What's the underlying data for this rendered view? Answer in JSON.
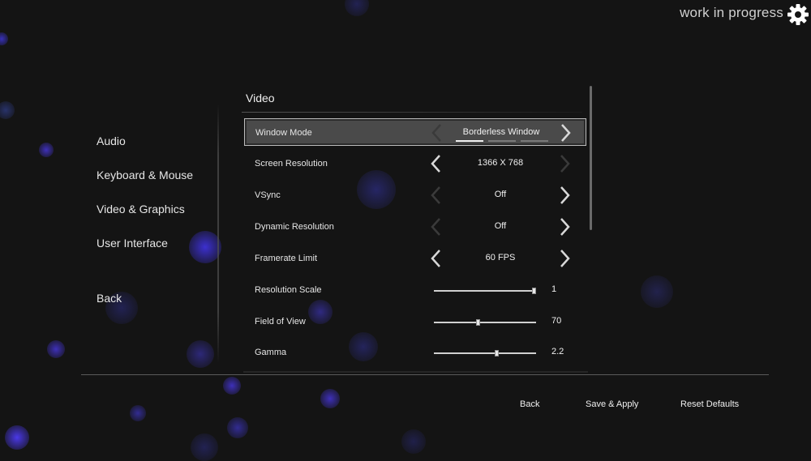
{
  "header": {
    "status_text": "work in progress",
    "settings_icon": "gear-icon"
  },
  "sidebar": {
    "items": [
      {
        "label": "Audio"
      },
      {
        "label": "Keyboard & Mouse"
      },
      {
        "label": "Video & Graphics"
      },
      {
        "label": "User Interface"
      }
    ],
    "back_label": "Back"
  },
  "section": {
    "title": "Video"
  },
  "settings": [
    {
      "label": "Window Mode",
      "value": "Borderless Window",
      "selected": true,
      "left_enabled": false,
      "right_enabled": true,
      "pips": 3,
      "active_pip": 0
    },
    {
      "label": "Screen Resolution",
      "value": "1366 X 768",
      "left_enabled": true,
      "right_enabled": false
    },
    {
      "label": "VSync",
      "value": "Off",
      "left_enabled": false,
      "right_enabled": true
    },
    {
      "label": "Dynamic Resolution",
      "value": "Off",
      "left_enabled": false,
      "right_enabled": true
    },
    {
      "label": "Framerate Limit",
      "value": "60 FPS",
      "left_enabled": true,
      "right_enabled": true
    }
  ],
  "sliders": [
    {
      "label": "Resolution Scale",
      "value": "1",
      "level": 1.0
    },
    {
      "label": "Field of View",
      "value": "70",
      "level": 0.43
    },
    {
      "label": "Gamma",
      "value": "2.2",
      "level": 0.62
    }
  ],
  "footer": {
    "back_label": "Back",
    "save_label": "Save & Apply",
    "reset_label": "Reset Defaults"
  },
  "colors": {
    "background": "#141414",
    "particle": "#4b3cff",
    "arrow_enabled": "#d8d8d8",
    "arrow_disabled": "#3a3a3a"
  }
}
